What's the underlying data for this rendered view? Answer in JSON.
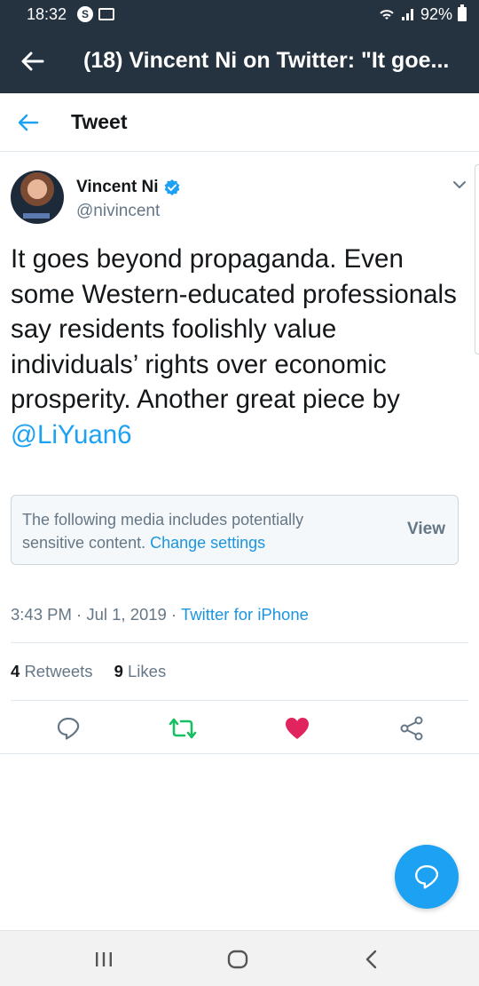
{
  "status_bar": {
    "time": "18:32",
    "battery": "92%",
    "app_icons": [
      "skype-icon",
      "mail-icon"
    ],
    "system_icons": [
      "wifi-icon",
      "signal-icon",
      "battery-icon"
    ]
  },
  "app_bar": {
    "title": "(18) Vincent Ni on Twitter: \"It goe..."
  },
  "tweet_header": {
    "title": "Tweet"
  },
  "author": {
    "name": "Vincent Ni",
    "handle": "@nivincent",
    "verified": true
  },
  "tweet": {
    "text": "It goes beyond propaganda. Even some Western-educated professionals say residents foolishly value individuals’ rights over economic prosperity. Another great piece by ",
    "mention": "@LiYuan6"
  },
  "sensitive_media": {
    "message": "The following media includes potentially sensitive content.",
    "link": "Change settings",
    "view_label": "View"
  },
  "meta": {
    "timestamp": "3:43 PM · Jul 1, 2019 · ",
    "source": "Twitter for iPhone"
  },
  "stats": {
    "retweets_count": "4",
    "retweets_label": "Retweets",
    "likes_count": "9",
    "likes_label": "Likes"
  },
  "colors": {
    "header_bg": "#253341",
    "accent": "#1da1f2",
    "retweet_green": "#17bf63",
    "like_red": "#e0245e",
    "muted": "#657786"
  }
}
